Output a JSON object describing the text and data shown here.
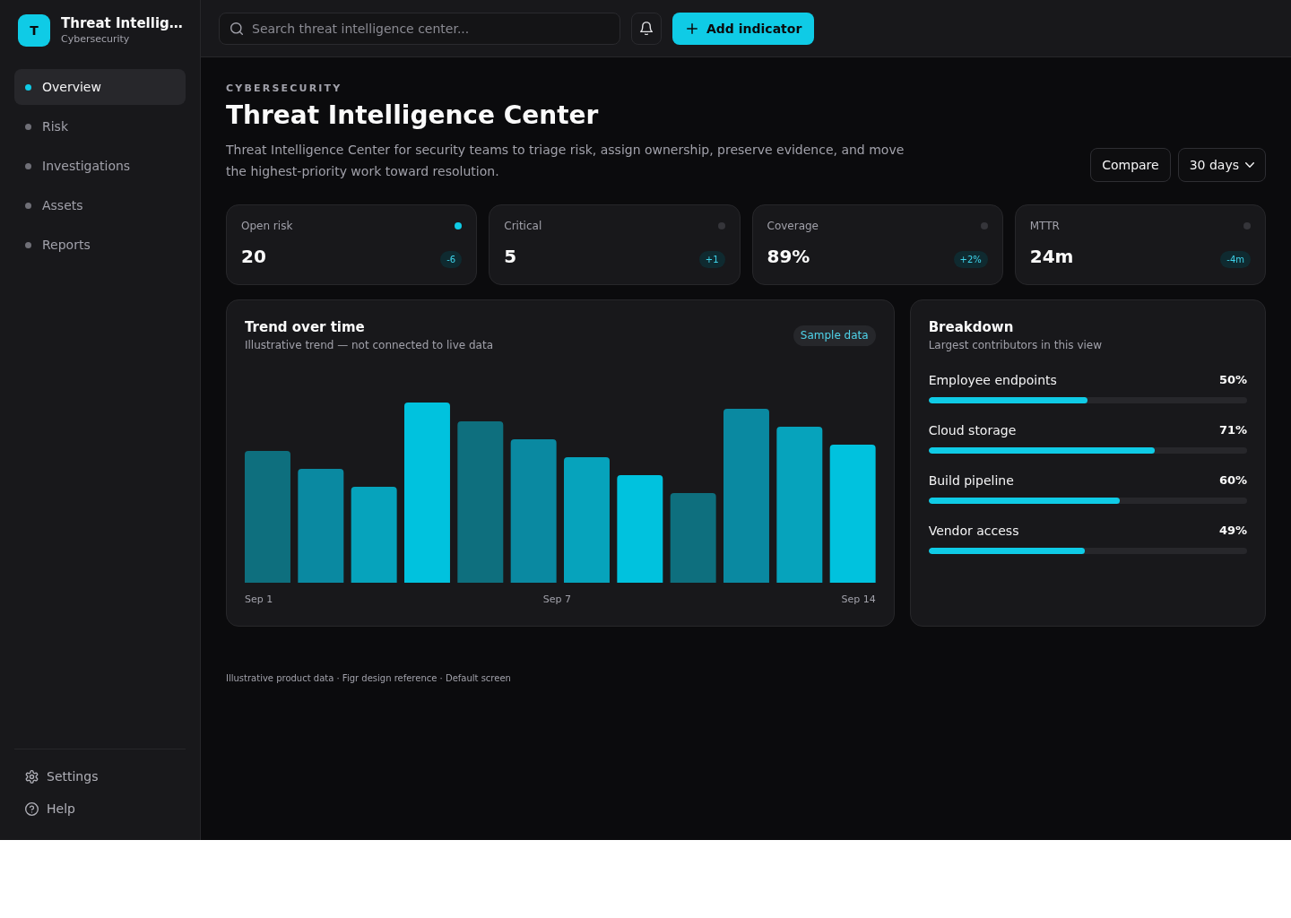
{
  "sidebar": {
    "brand": {
      "logo": "T",
      "title": "Threat Intellig…",
      "subtitle": "Cybersecurity"
    },
    "nav": [
      {
        "label": "Overview",
        "selected": true
      },
      {
        "label": "Risk",
        "selected": false
      },
      {
        "label": "Investigations",
        "selected": false
      },
      {
        "label": "Assets",
        "selected": false
      },
      {
        "label": "Reports",
        "selected": false
      }
    ],
    "footer_links": [
      {
        "label": "Settings",
        "kind": "settings"
      },
      {
        "label": "Help",
        "kind": "help"
      }
    ]
  },
  "top_bar": {
    "search": {
      "placeholder": "Search threat intelligence center..."
    },
    "primary_button": {
      "label": "Add indicator"
    }
  },
  "header": {
    "eyebrow": "CYBERSECURITY",
    "title": "Threat Intelligence Center",
    "description": "Threat Intelligence Center for security teams to triage risk, assign ownership, preserve evidence, and move the highest-priority work toward resolution.",
    "actions": [
      {
        "label": "Compare",
        "kind": "button"
      },
      {
        "label": "30 days",
        "kind": "dropdown"
      }
    ]
  },
  "kpis": [
    {
      "label": "Open risk",
      "value": "20",
      "change": "-6",
      "color": "#0fcbe6"
    },
    {
      "label": "Critical",
      "value": "5",
      "change": "+1",
      "color": "#35353a"
    },
    {
      "label": "Coverage",
      "value": "89%",
      "change": "+2%",
      "color": "#35353a"
    },
    {
      "label": "MTTR",
      "value": "24m",
      "change": "-4m",
      "color": "#35353a"
    }
  ],
  "trend": {
    "title": "Trend over time",
    "subtitle": "Illustrative trend — not connected to live data",
    "badge": "Sample data",
    "x_labels": [
      "Sep 1",
      "Sep 7",
      "Sep 14"
    ]
  },
  "breakdown": {
    "title": "Breakdown",
    "subtitle": "Largest contributors in this view",
    "items": [
      {
        "label": "Employee endpoints",
        "value": "50%",
        "level": 0.5
      },
      {
        "label": "Cloud storage",
        "value": "71%",
        "level": 0.71
      },
      {
        "label": "Build pipeline",
        "value": "60%",
        "level": 0.6
      },
      {
        "label": "Vendor access",
        "value": "49%",
        "level": 0.49
      }
    ]
  },
  "footer": "Illustrative product data · Figr design reference · Default screen"
}
